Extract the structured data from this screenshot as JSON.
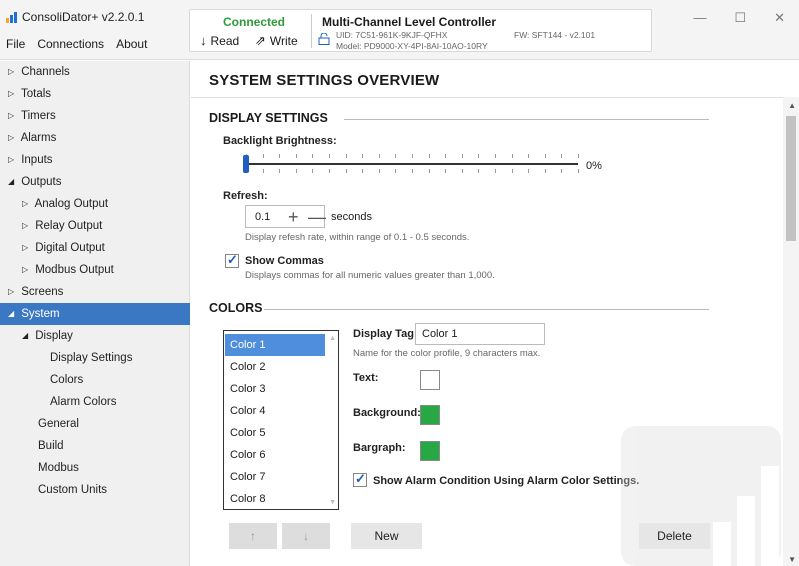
{
  "app": {
    "title": "ConsoliDator+ v2.2.0.1",
    "logo_icon": "bar-chart-logo-icon",
    "menu": [
      "File",
      "Connections",
      "About"
    ]
  },
  "connection": {
    "status": "Connected",
    "status_color": "#2e9b3a",
    "read_label": "Read",
    "write_label": "Write",
    "device_name": "Multi-Channel Level Controller",
    "uid": "UID: 7C51-961K-9KJF-QFHX",
    "model": "Model: PD9000-XY-4PI-8AI-10AO-10RY",
    "fw": "FW: SFT144 - v2.101"
  },
  "window_controls": [
    "—",
    "☐",
    "✕"
  ],
  "sidebar": {
    "items": [
      {
        "label": "Channels",
        "tri": "▷"
      },
      {
        "label": "Totals",
        "tri": "▷"
      },
      {
        "label": "Timers",
        "tri": "▷"
      },
      {
        "label": "Alarms",
        "tri": "▷"
      },
      {
        "label": "Inputs",
        "tri": "▷"
      },
      {
        "label": "Outputs",
        "tri": "◢"
      },
      {
        "label": "Analog Output",
        "tri": "▷"
      },
      {
        "label": "Relay Output",
        "tri": "▷"
      },
      {
        "label": "Digital Output",
        "tri": "▷"
      },
      {
        "label": "Modbus Output",
        "tri": "▷"
      },
      {
        "label": "Screens",
        "tri": "▷"
      },
      {
        "label": "System",
        "tri": "◢"
      },
      {
        "label": "Display",
        "tri": "◢"
      },
      {
        "label": "Display Settings",
        "tri": ""
      },
      {
        "label": "Colors",
        "tri": ""
      },
      {
        "label": "Alarm Colors",
        "tri": ""
      },
      {
        "label": "General",
        "tri": ""
      },
      {
        "label": "Build",
        "tri": ""
      },
      {
        "label": "Modbus",
        "tri": ""
      },
      {
        "label": "Custom Units",
        "tri": ""
      }
    ],
    "selected": "System",
    "selected_color": "#3b78c4"
  },
  "main": {
    "title": "SYSTEM SETTINGS OVERVIEW",
    "display_settings": {
      "heading": "DISPLAY SETTINGS",
      "backlight_label": "Backlight Brightness:",
      "backlight_value_text": "0%",
      "backlight_value": 0,
      "refresh_label": "Refresh:",
      "refresh_value": "0.1",
      "refresh_units": "seconds",
      "refresh_help": "Display refesh rate, within range of 0.1 - 0.5 seconds.",
      "show_commas_label": "Show Commas",
      "show_commas_checked": true,
      "show_commas_help": "Displays commas for all numeric values greater than 1,000."
    },
    "colors": {
      "heading": "COLORS",
      "list": [
        "Color 1",
        "Color 2",
        "Color 3",
        "Color 4",
        "Color 5",
        "Color 6",
        "Color 7",
        "Color 8"
      ],
      "selected": "Color 1",
      "display_tag_label": "Display Tag:",
      "display_tag_value": "Color 1",
      "display_tag_help": "Name for the color profile, 9 characters max.",
      "text_label": "Text:",
      "text_color": "#ffffff",
      "background_label": "Background:",
      "background_color": "#27a844",
      "bargraph_label": "Bargraph:",
      "bargraph_color": "#27a844",
      "alarm_condition_label": "Show Alarm Condition Using Alarm Color Settings.",
      "alarm_condition_checked": true
    },
    "buttons": {
      "up": "↑",
      "down": "↓",
      "new": "New",
      "delete": "Delete"
    }
  }
}
